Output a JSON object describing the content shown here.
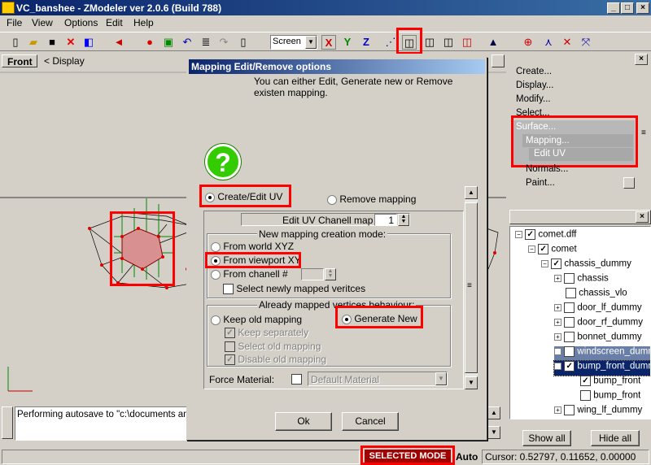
{
  "app": {
    "title": "VC_banshee - ZModeler ver 2.0.6 (Build 788)",
    "win_min": "_",
    "win_max": "□",
    "win_close": "×"
  },
  "menu": [
    "File",
    "View",
    "Options",
    "Edit",
    "Help"
  ],
  "toolbar": {
    "coord_system": "Screen",
    "axis_x": "X",
    "axis_y": "Y",
    "axis_z": "Z"
  },
  "viewport": {
    "name": "Front",
    "display_label": "< Display"
  },
  "right_panel": {
    "menu": [
      "Create...",
      "Display...",
      "Modify...",
      "Select...",
      "Surface...",
      "Mapping...",
      "Edit UV",
      "Normals...",
      "Paint..."
    ]
  },
  "tree": {
    "items": [
      {
        "label": "comet.dff",
        "checked": true,
        "expander": "−"
      },
      {
        "label": "comet",
        "checked": true,
        "expander": "−"
      },
      {
        "label": "chassis_dummy",
        "checked": true,
        "expander": "−"
      },
      {
        "label": "chassis",
        "checked": false,
        "expander": "+"
      },
      {
        "label": "chassis_vlo",
        "checked": false,
        "expander": ""
      },
      {
        "label": "door_lf_dummy",
        "checked": false,
        "expander": "+"
      },
      {
        "label": "door_rf_dummy",
        "checked": false,
        "expander": "+"
      },
      {
        "label": "bonnet_dummy",
        "checked": false,
        "expander": "+"
      },
      {
        "label": "windscreen_dummy",
        "checked": false,
        "expander": "+"
      },
      {
        "label": "bump_front_dummy",
        "checked": true,
        "expander": "−"
      },
      {
        "label": "bump_front",
        "checked": true,
        "expander": ""
      },
      {
        "label": "bump_front",
        "checked": false,
        "expander": ""
      },
      {
        "label": "wing_lf_dummy",
        "checked": false,
        "expander": "+"
      }
    ],
    "show_all": "Show all",
    "hide_all": "Hide all"
  },
  "log": {
    "text": "Performing autosave to \"c:\\documents and"
  },
  "status": {
    "mode": "SELECTED MODE",
    "auto": "Auto",
    "cursor": "Cursor: 0.52797, 0.11652, 0.00000"
  },
  "dialog": {
    "title": "Mapping Edit/Remove options",
    "description": "You can either Edit, Generate new or Remove existen mapping.",
    "icon": "?",
    "create_edit_uv": "Create/Edit UV",
    "remove_mapping": "Remove mapping",
    "edit_uv_channel_label": "Edit UV Chanell map #",
    "edit_uv_channel_value": "1",
    "mode_group_title": "New mapping creation mode:",
    "from_world_xyz": "From world XYZ",
    "from_viewport_xy": "From viewport XY",
    "from_channel": "From chanell #",
    "select_new_vertices": "Select newly mapped veritces",
    "behaviour_group_title": "Already mapped vertices behaviour:",
    "keep_old_mapping": "Keep old mapping",
    "generate_new": "Generate New",
    "keep_separately": "Keep separately",
    "select_old_mapping": "Select old mapping",
    "disable_old_mapping": "Disable old mapping",
    "force_material_label": "Force Material:",
    "force_material_value": "Default Material",
    "ok": "Ok",
    "cancel": "Cancel"
  },
  "colors": {
    "highlight": "#ff0000",
    "selection": "#0a246a"
  }
}
